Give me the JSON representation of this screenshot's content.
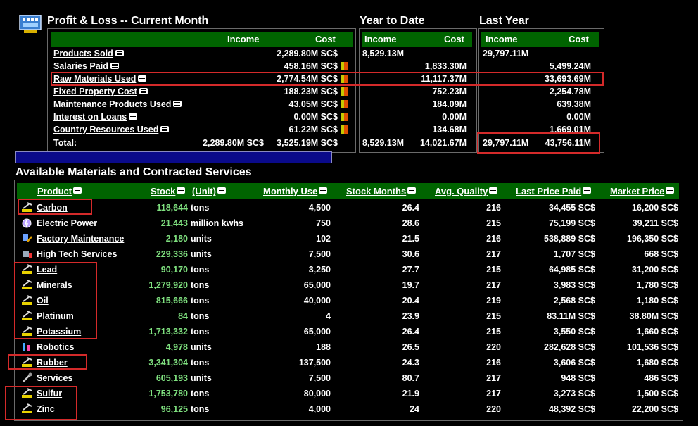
{
  "pl": {
    "title": "Profit & Loss -- Current Month",
    "ytd_title": "Year to Date",
    "ly_title": "Last Year",
    "head": {
      "income": "Income",
      "cost": "Cost"
    },
    "rows": [
      {
        "label": "Products Sold",
        "income": "2,289.80M SC$",
        "cost": "",
        "bar": false,
        "ytd_income": "8,529.13M",
        "ytd_cost": "",
        "ly_income": "29,797.11M",
        "ly_cost": ""
      },
      {
        "label": "Salaries Paid",
        "income": "",
        "cost": "458.16M SC$",
        "bar": true,
        "ytd_income": "",
        "ytd_cost": "1,833.30M",
        "ly_income": "",
        "ly_cost": "5,499.24M"
      },
      {
        "label": "Raw Materials Used",
        "income": "",
        "cost": "2,774.54M SC$",
        "bar": true,
        "ytd_income": "",
        "ytd_cost": "11,117.37M",
        "ly_income": "",
        "ly_cost": "33,693.69M"
      },
      {
        "label": "Fixed Property Cost",
        "income": "",
        "cost": "188.23M SC$",
        "bar": true,
        "ytd_income": "",
        "ytd_cost": "752.23M",
        "ly_income": "",
        "ly_cost": "2,254.78M"
      },
      {
        "label": "Maintenance Products Used",
        "income": "",
        "cost": "43.05M SC$",
        "bar": true,
        "ytd_income": "",
        "ytd_cost": "184.09M",
        "ly_income": "",
        "ly_cost": "639.38M"
      },
      {
        "label": "Interest on Loans",
        "income": "",
        "cost": "0.00M SC$",
        "bar": true,
        "ytd_income": "",
        "ytd_cost": "0.00M",
        "ly_income": "",
        "ly_cost": "0.00M"
      },
      {
        "label": "Country Resources Used",
        "income": "",
        "cost": "61.22M SC$",
        "bar": true,
        "ytd_income": "",
        "ytd_cost": "134.68M",
        "ly_income": "",
        "ly_cost": "1,669.01M"
      }
    ],
    "total": {
      "label": "Total:",
      "income": "2,289.80M SC$",
      "cost": "3,525.19M SC$",
      "ytd_income": "8,529.13M",
      "ytd_cost": "14,021.67M",
      "ly_income": "29,797.11M",
      "ly_cost": "43,756.11M"
    }
  },
  "materials": {
    "title": "Available Materials and Contracted Services",
    "headers": {
      "product": "Product",
      "stock": "Stock",
      "unit": "(Unit)",
      "monthly": "Monthly Use",
      "months": "Stock Months",
      "quality": "Avg. Quality",
      "last_price": "Last Price Paid",
      "market": "Market Price"
    },
    "rows": [
      {
        "icon": "mining-icon",
        "product": "Carbon",
        "stock": "118,644",
        "unit": "tons",
        "monthly": "4,500",
        "months": "26.4",
        "quality": "216",
        "last_price": "34,455 SC$",
        "market": "16,200 SC$"
      },
      {
        "icon": "power-icon",
        "product": "Electric Power",
        "stock": "21,443",
        "unit": "million kwhs",
        "monthly": "750",
        "months": "28.6",
        "quality": "215",
        "last_price": "75,199 SC$",
        "market": "39,211 SC$"
      },
      {
        "icon": "maintenance-icon",
        "product": "Factory Maintenance",
        "stock": "2,180",
        "unit": "units",
        "monthly": "102",
        "months": "21.5",
        "quality": "216",
        "last_price": "538,889 SC$",
        "market": "196,350 SC$"
      },
      {
        "icon": "tech-icon",
        "product": "High Tech Services",
        "stock": "229,336",
        "unit": "units",
        "monthly": "7,500",
        "months": "30.6",
        "quality": "217",
        "last_price": "1,707 SC$",
        "market": "668 SC$"
      },
      {
        "icon": "mining-icon",
        "product": "Lead",
        "stock": "90,170",
        "unit": "tons",
        "monthly": "3,250",
        "months": "27.7",
        "quality": "215",
        "last_price": "64,985 SC$",
        "market": "31,200 SC$"
      },
      {
        "icon": "mining-icon",
        "product": "Minerals",
        "stock": "1,279,920",
        "unit": "tons",
        "monthly": "65,000",
        "months": "19.7",
        "quality": "217",
        "last_price": "3,983 SC$",
        "market": "1,780 SC$"
      },
      {
        "icon": "mining-icon",
        "product": "Oil",
        "stock": "815,666",
        "unit": "tons",
        "monthly": "40,000",
        "months": "20.4",
        "quality": "219",
        "last_price": "2,568 SC$",
        "market": "1,180 SC$"
      },
      {
        "icon": "mining-icon",
        "product": "Platinum",
        "stock": "84",
        "unit": "tons",
        "monthly": "4",
        "months": "23.9",
        "quality": "215",
        "last_price": "83.11M SC$",
        "market": "38.80M SC$"
      },
      {
        "icon": "mining-icon",
        "product": "Potassium",
        "stock": "1,713,332",
        "unit": "tons",
        "monthly": "65,000",
        "months": "26.4",
        "quality": "215",
        "last_price": "3,550 SC$",
        "market": "1,660 SC$"
      },
      {
        "icon": "robotics-icon",
        "product": "Robotics",
        "stock": "4,978",
        "unit": "units",
        "monthly": "188",
        "months": "26.5",
        "quality": "220",
        "last_price": "282,628 SC$",
        "market": "101,536 SC$"
      },
      {
        "icon": "mining-icon",
        "product": "Rubber",
        "stock": "3,341,304",
        "unit": "tons",
        "monthly": "137,500",
        "months": "24.3",
        "quality": "216",
        "last_price": "3,606 SC$",
        "market": "1,680 SC$"
      },
      {
        "icon": "services-icon",
        "product": "Services",
        "stock": "605,193",
        "unit": "units",
        "monthly": "7,500",
        "months": "80.7",
        "quality": "217",
        "last_price": "948 SC$",
        "market": "486 SC$"
      },
      {
        "icon": "mining-icon",
        "product": "Sulfur",
        "stock": "1,753,780",
        "unit": "tons",
        "monthly": "80,000",
        "months": "21.9",
        "quality": "217",
        "last_price": "3,273 SC$",
        "market": "1,500 SC$"
      },
      {
        "icon": "mining-icon",
        "product": "Zinc",
        "stock": "96,125",
        "unit": "tons",
        "monthly": "4,000",
        "months": "24",
        "quality": "220",
        "last_price": "48,392 SC$",
        "market": "22,200 SC$"
      }
    ]
  },
  "colors": {
    "header_green": "#006400",
    "stock_green": "#7fe07f",
    "highlight_red": "#d42a2a",
    "background": "#000000"
  }
}
